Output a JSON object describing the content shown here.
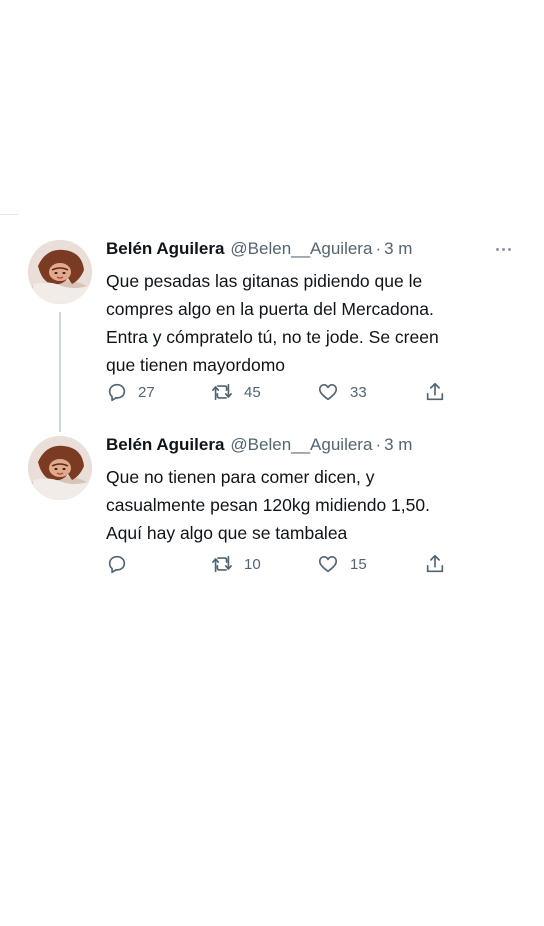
{
  "tweets": [
    {
      "author": {
        "display_name": "Belén Aguilera",
        "handle": "@Belen__Aguilera",
        "separator": "·",
        "time": "3 m"
      },
      "text_lines": [
        "Que pesadas las gitanas pidiendo que le",
        "compres algo en la puerta del Mercadona.",
        "Entra y cómpratelo tú, no te jode. Se creen",
        "que tienen mayordomo"
      ],
      "actions": {
        "replies": "27",
        "retweets": "45",
        "likes": "33"
      }
    },
    {
      "author": {
        "display_name": "Belén Aguilera",
        "handle": "@Belen__Aguilera",
        "separator": "·",
        "time": "3 m"
      },
      "text_lines": [
        "Que no tienen para comer dicen, y",
        "casualmente pesan 120kg midiendo 1,50.",
        "Aquí hay algo que se tambalea"
      ],
      "actions": {
        "replies": "",
        "retweets": "10",
        "likes": "15"
      }
    }
  ],
  "colors": {
    "text_primary": "#0f1419",
    "text_secondary": "#536471",
    "thread_line": "#cfd9de",
    "background": "#ffffff"
  },
  "icons": [
    "more-icon",
    "reply-icon",
    "retweet-icon",
    "like-icon",
    "share-icon"
  ]
}
